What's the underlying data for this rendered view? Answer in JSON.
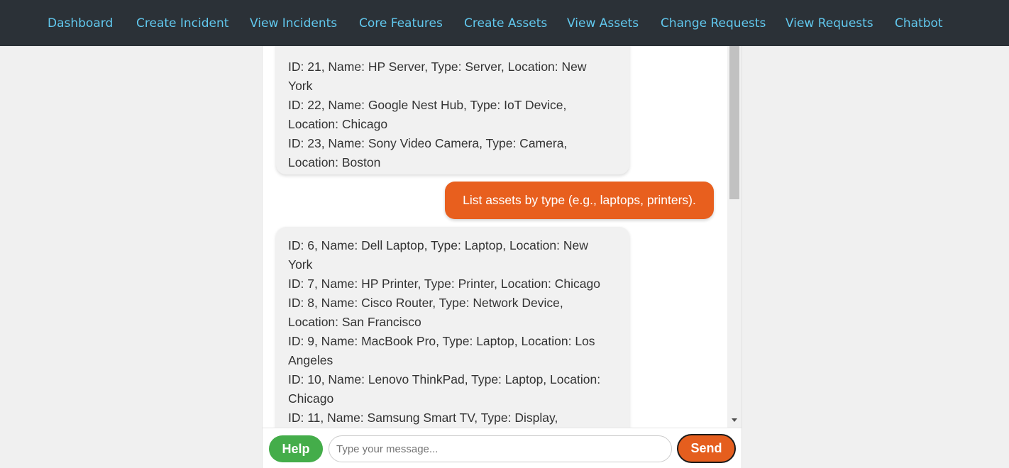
{
  "nav": {
    "links": [
      "Dashboard",
      "Create Incident",
      "View Incidents",
      "Core Features",
      "Create Assets",
      "View Assets",
      "Change Requests",
      "View Requests",
      "Chatbot"
    ]
  },
  "chat": {
    "messages": [
      {
        "sender": "bot",
        "lines": [
          "ID: 21, Name: HP Server, Type: Server, Location: New",
          "York",
          "ID: 22, Name: Google Nest Hub, Type: IoT Device,",
          "Location: Chicago",
          "ID: 23, Name: Sony Video Camera, Type: Camera,",
          "Location: Boston"
        ]
      },
      {
        "sender": "user",
        "text": "List assets by type (e.g., laptops, printers)."
      },
      {
        "sender": "bot",
        "lines": [
          "ID: 6, Name: Dell Laptop, Type: Laptop, Location: New",
          "York",
          "ID: 7, Name: HP Printer, Type: Printer, Location: Chicago",
          "ID: 8, Name: Cisco Router, Type: Network Device,",
          "Location: San Francisco",
          "ID: 9, Name: MacBook Pro, Type: Laptop, Location: Los",
          "Angeles",
          "ID: 10, Name: Lenovo ThinkPad, Type: Laptop, Location:",
          "Chicago",
          "ID: 11, Name: Samsung Smart TV, Type: Display,"
        ]
      }
    ],
    "help_label": "Help",
    "input_placeholder": "Type your message...",
    "input_value": "",
    "send_label": "Send"
  },
  "colors": {
    "navbar_bg": "#2b3137",
    "nav_link": "#61c8ee",
    "user_bubble": "#e85f1e",
    "bot_bubble": "#f1f1f1",
    "help_button": "#44ad4a",
    "send_button": "#e55e1e"
  },
  "icons": {
    "scroll_down": "scroll-down-arrow-icon"
  }
}
